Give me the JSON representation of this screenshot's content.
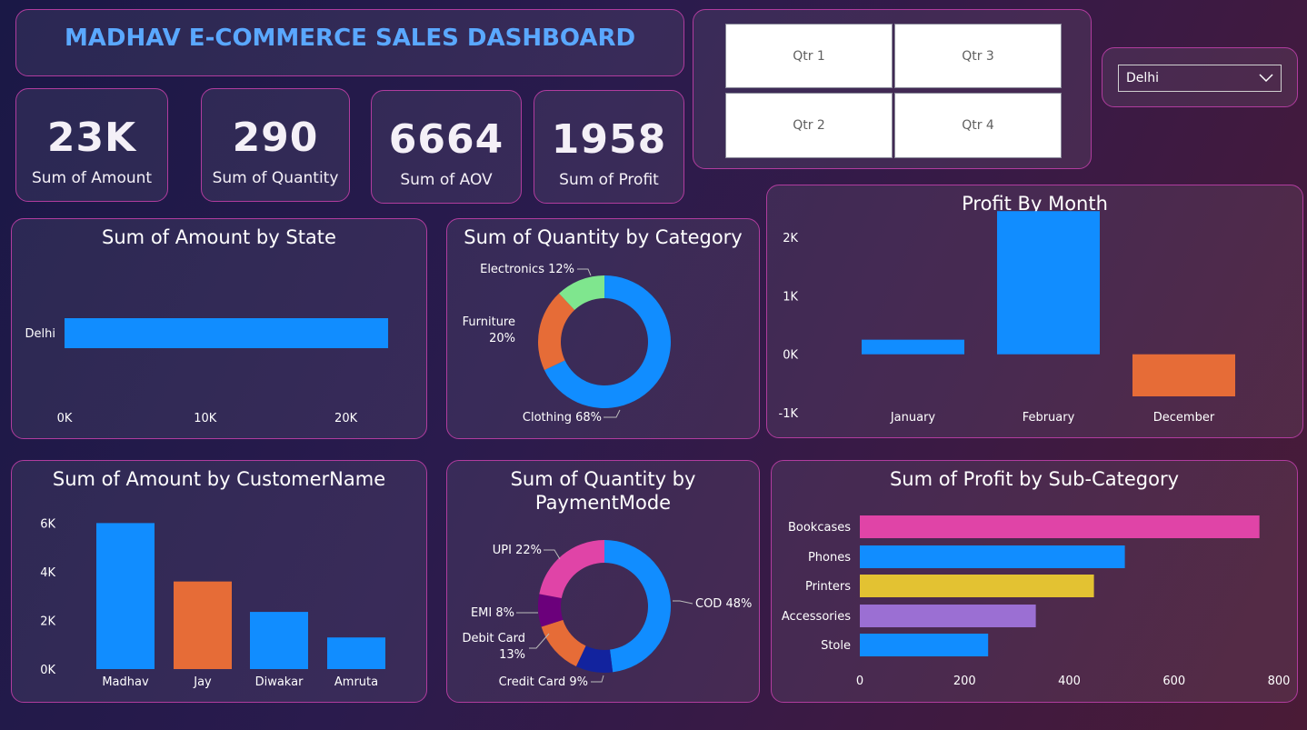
{
  "title": "MADHAV E-COMMERCE SALES DASHBOARD",
  "kpis": [
    {
      "value": "23K",
      "label": "Sum of Amount"
    },
    {
      "value": "290",
      "label": "Sum of Quantity"
    },
    {
      "value": "6664",
      "label": "Sum of AOV"
    },
    {
      "value": "1958",
      "label": "Sum of Profit"
    }
  ],
  "quarters": [
    "Qtr 1",
    "Qtr 3",
    "Qtr 2",
    "Qtr 4"
  ],
  "state_filter": {
    "selected": "Delhi"
  },
  "colors": {
    "blue": "#118dff",
    "orange": "#e66c37",
    "green": "#7fe68e",
    "pink": "#e044a7",
    "purple": "#6b007b",
    "navy": "#12239e",
    "yellow": "#e3c232",
    "lavender": "#9b6fd3",
    "border": "#b03c9e"
  },
  "chart_data": [
    {
      "id": "amount_by_state",
      "type": "bar",
      "orientation": "horizontal",
      "title": "Sum of Amount by State",
      "categories": [
        "Delhi"
      ],
      "values": [
        23000
      ],
      "xlim": [
        0,
        25000
      ],
      "ticks": [
        "0K",
        "10K",
        "20K"
      ],
      "tick_values": [
        0,
        10000,
        20000
      ]
    },
    {
      "id": "quantity_by_category",
      "type": "pie",
      "donut": true,
      "title": "Sum of Quantity by Category",
      "slices": [
        {
          "label": "Clothing 68%",
          "value": 68
        },
        {
          "label": "Furniture 20%",
          "value": 20
        },
        {
          "label": "Electronics 12%",
          "value": 12
        }
      ]
    },
    {
      "id": "profit_by_month",
      "type": "bar",
      "title": "Profit By Month",
      "categories": [
        "January",
        "February",
        "December"
      ],
      "values": [
        250,
        2450,
        -720
      ],
      "ylim": [
        -1000,
        2500
      ],
      "ticks": [
        "2K",
        "1K",
        "0K",
        "-1K"
      ],
      "tick_values": [
        2000,
        1000,
        0,
        -1000
      ]
    },
    {
      "id": "amount_by_customer",
      "type": "bar",
      "title": "Sum of Amount by CustomerName",
      "categories": [
        "Madhav",
        "Jay",
        "Diwakar",
        "Amruta"
      ],
      "values": [
        6000,
        3600,
        2350,
        1300
      ],
      "ylim": [
        0,
        6500
      ],
      "ticks": [
        "6K",
        "4K",
        "2K",
        "0K"
      ],
      "tick_values": [
        6000,
        4000,
        2000,
        0
      ]
    },
    {
      "id": "quantity_by_paymentmode",
      "type": "pie",
      "donut": true,
      "title": "Sum of Quantity by PaymentMode",
      "slices": [
        {
          "label": "COD 48%",
          "value": 48
        },
        {
          "label": "Credit Card 9%",
          "value": 9
        },
        {
          "label": "Debit Card 13%",
          "value": 13
        },
        {
          "label": "EMI 8%",
          "value": 8
        },
        {
          "label": "UPI 22%",
          "value": 22
        }
      ]
    },
    {
      "id": "profit_by_subcategory",
      "type": "bar",
      "orientation": "horizontal",
      "title": "Sum of Profit by Sub-Category",
      "categories": [
        "Bookcases",
        "Phones",
        "Printers",
        "Accessories",
        "Stole"
      ],
      "values": [
        763,
        506,
        447,
        336,
        245
      ],
      "xlim": [
        0,
        800
      ],
      "ticks": [
        "0",
        "200",
        "400",
        "600",
        "800"
      ],
      "tick_values": [
        0,
        200,
        400,
        600,
        800
      ]
    }
  ]
}
